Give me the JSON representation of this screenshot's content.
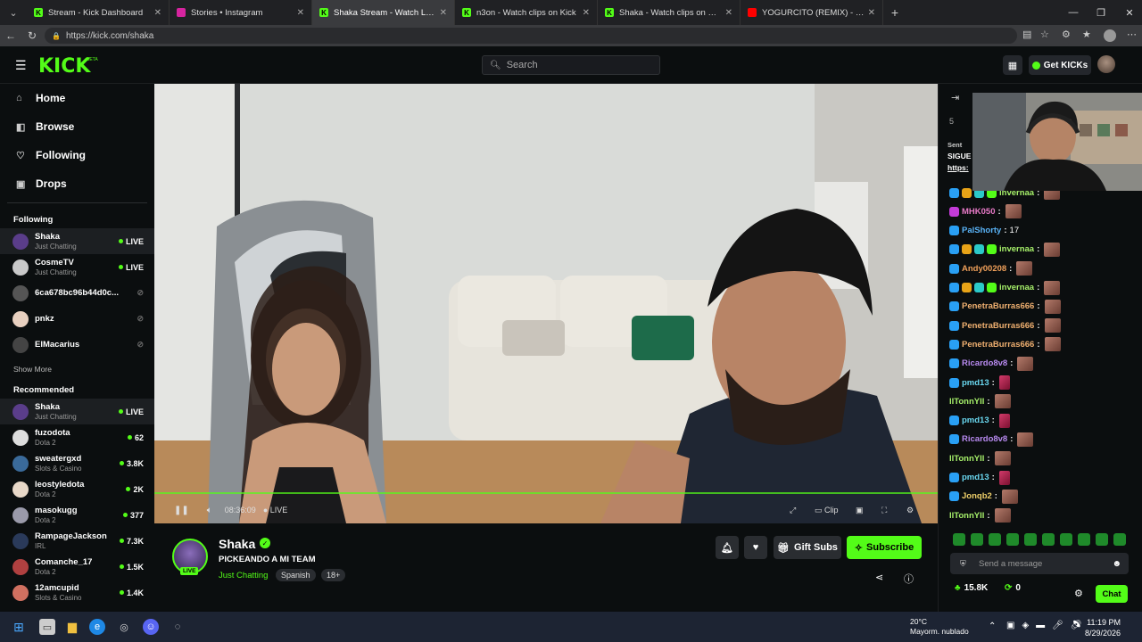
{
  "browser": {
    "tabs": [
      {
        "title": "Stream - Kick Dashboard",
        "icon": "kick-icon",
        "active": false
      },
      {
        "title": "Stories • Instagram",
        "icon": "instagram-icon",
        "active": false
      },
      {
        "title": "Shaka Stream - Watch Live on Kick",
        "icon": "kick-icon",
        "active": true
      },
      {
        "title": "n3on - Watch clips on Kick",
        "icon": "kick-icon",
        "active": false
      },
      {
        "title": "Shaka - Watch clips on Kick",
        "icon": "kick-icon",
        "active": false
      },
      {
        "title": "YOGURCITO (REMIX) - Blessd, Anu",
        "icon": "youtube-icon",
        "active": false
      }
    ],
    "url": "https://kick.com/shaka"
  },
  "topnav": {
    "logo": "KICK",
    "logo_badge": "BETA",
    "search_placeholder": "Search",
    "get_kicks_label": "Get KICKs"
  },
  "sidebar": {
    "main": [
      {
        "label": "Home",
        "icon": "home-icon"
      },
      {
        "label": "Browse",
        "icon": "browse-icon"
      },
      {
        "label": "Following",
        "icon": "heart-icon"
      },
      {
        "label": "Drops",
        "icon": "gift-icon"
      }
    ],
    "following_heading": "Following",
    "following": [
      {
        "name": "Shaka",
        "category": "Just Chatting",
        "status": "LIVE",
        "selected": true,
        "color": "#5a3d8a"
      },
      {
        "name": "CosmeTV",
        "category": "Just Chatting",
        "status": "LIVE",
        "selected": false,
        "color": "#c9c9c9"
      },
      {
        "name": "6ca678bc96b44d0c...",
        "category": "",
        "status": "",
        "selected": false,
        "color": "#555"
      },
      {
        "name": "pnkz",
        "category": "",
        "status": "",
        "selected": false,
        "color": "#e8d0c0"
      },
      {
        "name": "ElMacarius",
        "category": "",
        "status": "",
        "selected": false,
        "color": "#444"
      }
    ],
    "show_more": "Show More",
    "recommended_heading": "Recommended",
    "recommended": [
      {
        "name": "Shaka",
        "category": "Just Chatting",
        "status": "LIVE",
        "selected": true,
        "color": "#5a3d8a"
      },
      {
        "name": "fuzodota",
        "category": "Dota 2",
        "status": "62",
        "selected": false,
        "color": "#ddd"
      },
      {
        "name": "sweatergxd",
        "category": "Slots & Casino",
        "status": "3.8K",
        "selected": false,
        "color": "#3a6a9a"
      },
      {
        "name": "leostyledota",
        "category": "Dota 2",
        "status": "2K",
        "selected": false,
        "color": "#e8d8c8"
      },
      {
        "name": "masokugg",
        "category": "Dota 2",
        "status": "377",
        "selected": false,
        "color": "#9a9aaa"
      },
      {
        "name": "RampageJackson",
        "category": "IRL",
        "status": "7.3K",
        "selected": false,
        "color": "#2a3a5a"
      },
      {
        "name": "Comanche_17",
        "category": "Dota 2",
        "status": "1.5K",
        "selected": false,
        "color": "#b04040"
      },
      {
        "name": "12amcupid",
        "category": "Slots & Casino",
        "status": "1.4K",
        "selected": false,
        "color": "#d07060"
      }
    ]
  },
  "player": {
    "time": "08:36:09",
    "live_label": "LIVE",
    "clip_label": "Clip",
    "progress": 1.0
  },
  "stream_info": {
    "channel": "Shaka",
    "title": "PICKEANDO A MI TEAM",
    "category": "Just Chatting",
    "tags": [
      "Spanish",
      "18+"
    ],
    "live_badge": "LIVE",
    "gift_subs_label": "Gift Subs",
    "subscribe_label": "Subscribe"
  },
  "chat": {
    "pinned_count": "5",
    "pinned_author": "Sent",
    "pinned_text": "SIGUE",
    "pinned_link": "https:",
    "messages": [
      {
        "user": "invernaa",
        "color": "#a6f06a",
        "text": "",
        "emote": true,
        "badges": [
          "#29a0f5",
          "#e8a317",
          "#2bc9c9",
          "#53fc18"
        ]
      },
      {
        "user": "MHK050",
        "color": "#e87ac8",
        "text": "",
        "emote": true,
        "badges": [
          "#c43bd9"
        ]
      },
      {
        "user": "PalShorty",
        "color": "#5ab4f8",
        "text": "17",
        "emote": false,
        "badges": [
          "#29a0f5"
        ]
      },
      {
        "user": "invernaa",
        "color": "#a6f06a",
        "text": "",
        "emote": true,
        "badges": [
          "#29a0f5",
          "#e8a317",
          "#2bc9c9",
          "#53fc18"
        ]
      },
      {
        "user": "Andy00208",
        "color": "#f0a05a",
        "text": "",
        "emote": true,
        "badges": [
          "#29a0f5"
        ]
      },
      {
        "user": "invernaa",
        "color": "#a6f06a",
        "text": "",
        "emote": true,
        "badges": [
          "#29a0f5",
          "#e8a317",
          "#2bc9c9",
          "#53fc18"
        ]
      },
      {
        "user": "PenetraBurras666",
        "color": "#f0b070",
        "text": "",
        "emote": true,
        "badges": [
          "#29a0f5"
        ]
      },
      {
        "user": "PenetraBurras666",
        "color": "#f0b070",
        "text": "",
        "emote": true,
        "badges": [
          "#29a0f5"
        ]
      },
      {
        "user": "PenetraBurras666",
        "color": "#f0b070",
        "text": "",
        "emote": true,
        "badges": [
          "#29a0f5"
        ]
      },
      {
        "user": "Ricardo8v8",
        "color": "#b88af0",
        "text": "",
        "emote": true,
        "badges": [
          "#29a0f5"
        ]
      },
      {
        "user": "pmd13",
        "color": "#6ad8f0",
        "text": "",
        "emote": "b",
        "badges": [
          "#29a0f5"
        ]
      },
      {
        "user": "IlTonnYIl",
        "color": "#a6f06a",
        "text": "",
        "emote": true,
        "badges": []
      },
      {
        "user": "pmd13",
        "color": "#6ad8f0",
        "text": "",
        "emote": "b",
        "badges": [
          "#29a0f5"
        ]
      },
      {
        "user": "Ricardo8v8",
        "color": "#b88af0",
        "text": "",
        "emote": true,
        "badges": [
          "#29a0f5"
        ]
      },
      {
        "user": "IlTonnYIl",
        "color": "#a6f06a",
        "text": "",
        "emote": true,
        "badges": []
      },
      {
        "user": "pmd13",
        "color": "#6ad8f0",
        "text": "",
        "emote": "b",
        "badges": [
          "#29a0f5"
        ]
      },
      {
        "user": "Jonqb2",
        "color": "#f0d06a",
        "text": "",
        "emote": true,
        "badges": [
          "#29a0f5"
        ]
      },
      {
        "user": "IlTonnYIl",
        "color": "#a6f06a",
        "text": "",
        "emote": true,
        "badges": []
      }
    ],
    "input_placeholder": "Send a message",
    "kicks": "15.8K",
    "points": "0",
    "chat_button": "Chat"
  },
  "taskbar": {
    "temperature": "20°C",
    "weather": "Mayorm. nublado",
    "time": "11:19 PM",
    "date": "8/29/2026"
  }
}
